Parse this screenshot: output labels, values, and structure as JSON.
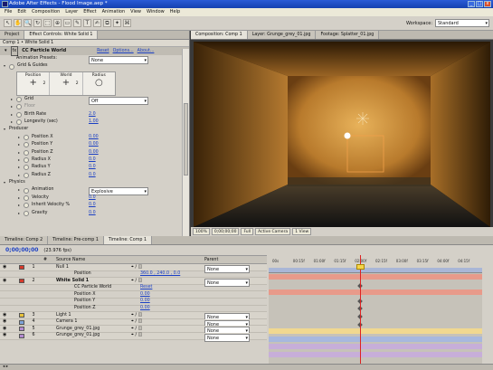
{
  "window": {
    "title": "Adobe After Effects - Flood Image.aep *",
    "controls": [
      "_",
      "□",
      "x"
    ]
  },
  "menu": [
    "File",
    "Edit",
    "Composition",
    "Layer",
    "Effect",
    "Animation",
    "View",
    "Window",
    "Help"
  ],
  "toolbar": {
    "tools": [
      "↖",
      "✋",
      "🔍",
      "↻",
      "⬚",
      "⊕",
      "▭",
      "✎",
      "T",
      "✍",
      "⧉",
      "✦",
      "⌘"
    ],
    "workspace_label": "Workspace:",
    "workspace_value": "Standard"
  },
  "effect_panel": {
    "tabs": [
      "Project",
      "Effect Controls: White Solid 1"
    ],
    "subtitle": "Comp 1 • White Solid 1",
    "effect_name": "CC Particle World",
    "reset": "Reset",
    "options": "Options...",
    "about": "About...",
    "animation_presets_label": "Animation Presets:",
    "animation_presets_value": "None",
    "gridaxis_header": "Grid & Guides",
    "sim_cells": [
      {
        "label": "Position",
        "num": "2"
      },
      {
        "label": "World",
        "num": "2"
      },
      {
        "label": "Radius",
        "num": ""
      }
    ],
    "rows": [
      {
        "label": "Grid",
        "value": "Off",
        "dropdown": true,
        "indent": 1
      },
      {
        "label": "Floor",
        "value": "",
        "indent": 1,
        "dim": true
      },
      {
        "label": "Birth Rate",
        "value": "2.0",
        "indent": 1
      },
      {
        "label": "Longevity (sec)",
        "value": "1.00",
        "indent": 1
      },
      {
        "label": "Producer",
        "value": "",
        "indent": 0,
        "section": true
      },
      {
        "label": "Position X",
        "value": "0.00",
        "indent": 2
      },
      {
        "label": "Position Y",
        "value": "0.00",
        "indent": 2
      },
      {
        "label": "Position Z",
        "value": "0.00",
        "indent": 2
      },
      {
        "label": "Radius X",
        "value": "0.0",
        "indent": 2
      },
      {
        "label": "Radius Y",
        "value": "0.0",
        "indent": 2
      },
      {
        "label": "Radius Z",
        "value": "0.0",
        "indent": 2
      },
      {
        "label": "Physics",
        "value": "",
        "indent": 0,
        "section": true
      },
      {
        "label": "Animation",
        "value": "Explosive",
        "dropdown": true,
        "indent": 2
      },
      {
        "label": "Velocity",
        "value": "0.0",
        "indent": 2
      },
      {
        "label": "Inherit Velocity %",
        "value": "0.0",
        "indent": 2
      },
      {
        "label": "Gravity",
        "value": "0.0",
        "indent": 2
      }
    ]
  },
  "comp_panel": {
    "tabs": [
      "Composition: Comp 1",
      "Layer: Grunge_grey_01.jpg",
      "Footage: Splatter_01.jpg"
    ],
    "bottom": [
      "100%",
      "0;00;00;00",
      "Full",
      "Active Camera",
      "1 View"
    ]
  },
  "timeline": {
    "tabs": [
      "Timeline: Comp 2",
      "Timeline: Pre-comp 1",
      "Timeline: Comp 1"
    ],
    "timecode": "0;00;00;00",
    "fps": "(23.976 fps)",
    "columns": [
      "#",
      "Source Name",
      "Parent"
    ],
    "ruler_ticks": [
      "00s",
      "00:15f",
      "01:00f",
      "01:15f",
      "02:00f",
      "02:15f",
      "03:00f",
      "03:15f",
      "04:00f",
      "04:15f"
    ],
    "layers": [
      {
        "num": "1",
        "name": "Null 1",
        "label_color": "#d63a2a",
        "parent": "None",
        "bar_color": "#e89a8a",
        "bold": false
      },
      {
        "name": "Position",
        "value": "360.0 , 240.0 , 0.0",
        "prop": true
      },
      {
        "num": "2",
        "name": "White Solid 1",
        "label_color": "#d63a2a",
        "parent": "None",
        "bar_color": "#e89a8a",
        "bold": true
      },
      {
        "name": "CC Particle World",
        "value": "Reset",
        "prop": true
      },
      {
        "name": "Position X",
        "value": "0.00",
        "prop": true
      },
      {
        "name": "Position Y",
        "value": "0.00",
        "prop": true
      },
      {
        "name": "Position Z",
        "value": "0.00",
        "prop": true
      },
      {
        "num": "3",
        "name": "Light 1",
        "label_color": "#e8c23a",
        "parent": "None",
        "bar_color": "#f0d890",
        "bold": false
      },
      {
        "num": "4",
        "name": "Camera 1",
        "label_color": "#7da3d9",
        "parent": "None",
        "bar_color": "#a7b8de",
        "bold": false
      },
      {
        "num": "5",
        "name": "Grunge_grey_01.jpg",
        "label_color": "#b38ad0",
        "parent": "None",
        "bar_color": "#c7aed9",
        "bold": false
      },
      {
        "num": "6",
        "name": "Grunge_grey_01.jpg",
        "label_color": "#b38ad0",
        "parent": "None",
        "bar_color": "#c7aed9",
        "bold": false
      }
    ]
  }
}
